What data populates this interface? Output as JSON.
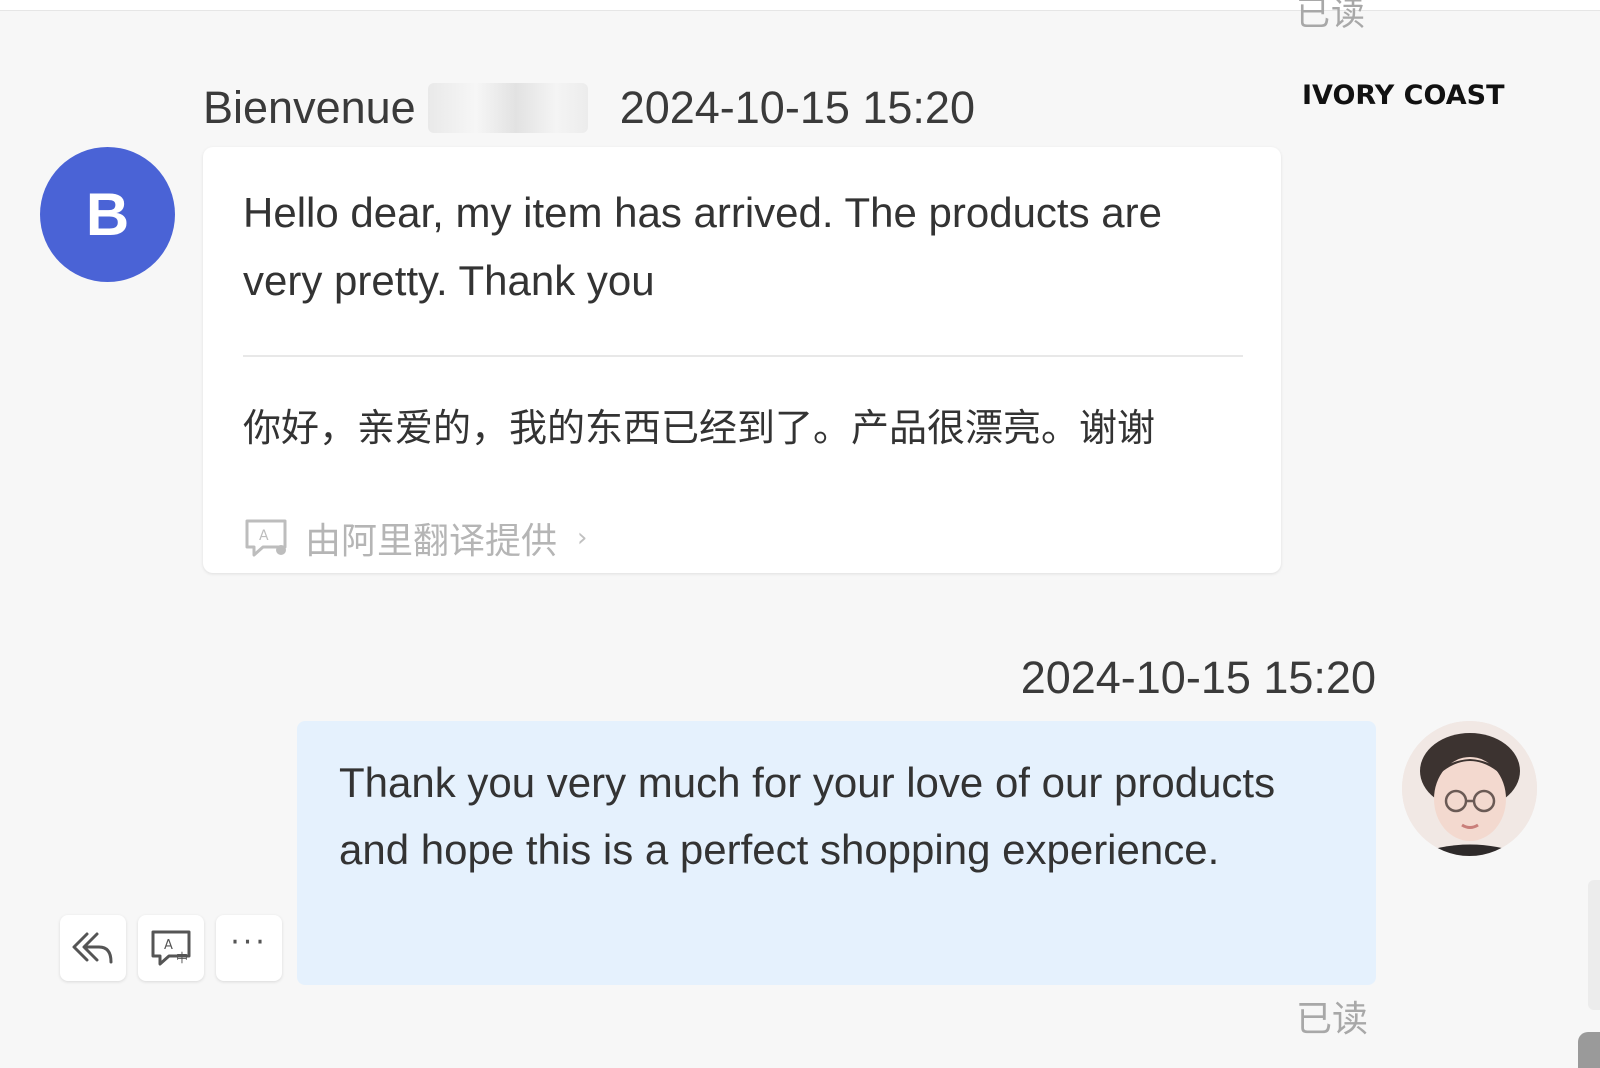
{
  "overlay_label": "IVORY COAST",
  "top_partial_status": "已读",
  "incoming": {
    "avatar_letter": "B",
    "sender_name": "Bienvenue",
    "timestamp": "2024-10-15 15:20",
    "message": "Hello dear, my item has arrived. The products are very pretty. Thank you",
    "translation": "你好，亲爱的，我的东西已经到了。产品很漂亮。谢谢",
    "translation_provider": "由阿里翻译提供",
    "provider_chevron": "›",
    "avatar_color": "#4a63d6"
  },
  "outgoing": {
    "timestamp": "2024-10-15 15:20",
    "message": "Thank you very much for your love of our products and hope this is a perfect shopping experience.",
    "status": "已读",
    "bubble_color": "#e5f1fd"
  },
  "actions": {
    "reply_icon": "reply-icon",
    "translate_icon": "translate-icon",
    "more_label": "···"
  }
}
